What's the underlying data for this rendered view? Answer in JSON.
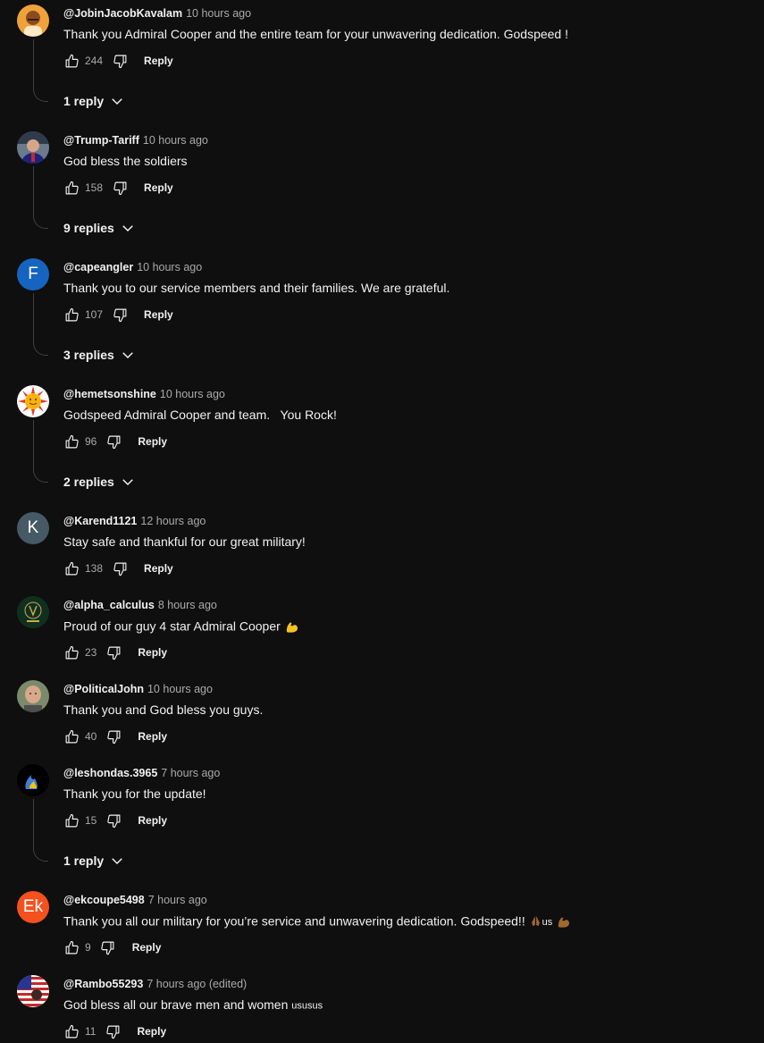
{
  "comments": [
    {
      "handle": "@JobinJacobKavalam",
      "time": "10 hours ago",
      "text": "Thank you Admiral Cooper and the entire team for your unwavering dedication. Godspeed !",
      "likes": "244",
      "reply_label": "Reply",
      "replies_label": "1 reply",
      "avatar": "photo-orange"
    },
    {
      "handle": "@Trump-Tariff",
      "time": "10 hours ago",
      "text": "God bless the soldiers",
      "likes": "158",
      "reply_label": "Reply",
      "replies_label": "9 replies",
      "avatar": "photo-man"
    },
    {
      "handle": "@capeangler",
      "time": "10 hours ago",
      "text": "Thank you to our service members and their families. We are grateful.",
      "likes": "107",
      "reply_label": "Reply",
      "replies_label": "3 replies",
      "avatar_letter": "F",
      "avatar_color": "#1565c0"
    },
    {
      "handle": "@hemetsonshine",
      "time": "10 hours ago",
      "text": "Godspeed Admiral Cooper and team.   You Rock!",
      "likes": "96",
      "reply_label": "Reply",
      "replies_label": "2 replies",
      "avatar": "sun"
    },
    {
      "handle": "@Karend1121",
      "time": "12 hours ago",
      "text": "Stay safe and thankful for our great military!",
      "likes": "138",
      "reply_label": "Reply",
      "avatar_letter": "K",
      "avatar_color": "#455a64"
    },
    {
      "handle": "@alpha_calculus",
      "time": "8 hours ago",
      "text": "Proud of our guy 4 star Admiral Cooper",
      "likes": "23",
      "reply_label": "Reply",
      "avatar": "alpha-logo"
    },
    {
      "handle": "@PoliticalJohn",
      "time": "10 hours ago",
      "text": "Thank you and God bless you guys.",
      "likes": "40",
      "reply_label": "Reply",
      "avatar": "photo-bald"
    },
    {
      "handle": "@leshondas.3965",
      "time": "7 hours ago",
      "text": "Thank you for the update!",
      "likes": "15",
      "reply_label": "Reply",
      "replies_label": "1 reply",
      "avatar": "flame"
    },
    {
      "handle": "@ekcoupe5498",
      "time": "7 hours ago",
      "text": "Thank you all our military for you’re service and unwavering dedication. Godspeed!!",
      "text_suffix": "us",
      "likes": "9",
      "reply_label": "Reply",
      "avatar_letter": "Ek",
      "avatar_color": "#f4511e"
    },
    {
      "handle": "@Rambo55293",
      "time": "7 hours ago (edited)",
      "text": "God bless all our brave men and women",
      "text_suffix": "ususus",
      "likes": "11",
      "reply_label": "Reply",
      "avatar": "us-flag"
    }
  ],
  "colors": {
    "background": "#0f0f0f",
    "text": "#f1f1f1",
    "secondary": "#aaaaaa"
  }
}
